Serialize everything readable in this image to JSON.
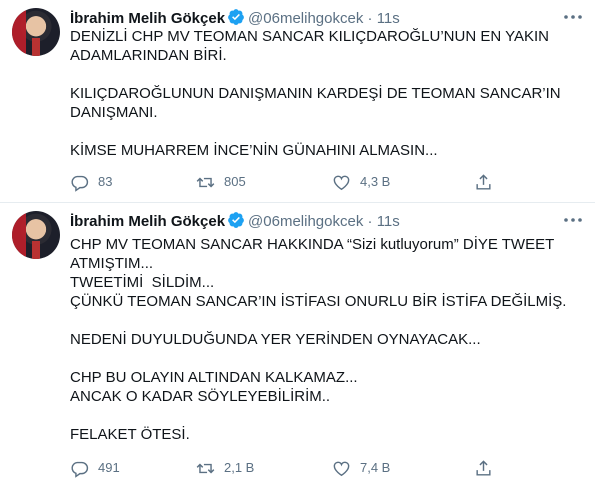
{
  "tweets": [
    {
      "author_name": "İbrahim Melih Gökçek",
      "handle": "@06melihgokcek",
      "separator": "·",
      "time": "11s",
      "text": "DENİZLİ CHP MV TEOMAN SANCAR KILIÇDAROĞLU’NUN EN YAKIN ADAMLARINDAN BİRİ.\n\nKILIÇDAROĞLUNUN DANIŞMANIN KARDEŞİ DE TEOMAN SANCAR’IN DANIŞMANI.\n\nKİMSE MUHARREM İNCE’NİN GÜNAHINI ALMASIN...",
      "replies": "83",
      "retweets": "805",
      "likes": "4,3 B"
    },
    {
      "author_name": "İbrahim Melih Gökçek",
      "handle": "@06melihgokcek",
      "separator": "·",
      "time": "11s",
      "text": "CHP MV TEOMAN SANCAR HAKKINDA “Sizi kutluyorum” DİYE TWEET ATMIŞTIM...\nTWEETİMİ  SİLDİM...\nÇÜNKÜ TEOMAN SANCAR’IN İSTİFASI ONURLU BİR İSTİFA DEĞİLMİŞ.\n\nNEDENİ DUYULDUĞUNDA YER YERİNDEN OYNAYACAK...\n\nCHP BU OLAYIN ALTINDAN KALKAMAZ...\nANCAK O KADAR SÖYLEYEBİLİRİM..\n\nFELAKET ÖTESİ.",
      "replies": "491",
      "retweets": "2,1 B",
      "likes": "7,4 B"
    }
  ],
  "colors": {
    "accent": "#1da1f2",
    "muted": "#5b7083",
    "text": "#0f1419",
    "divider": "#e6ecf0"
  },
  "icons": {
    "more": "more-horizontal-icon",
    "verified": "verified-badge-icon",
    "reply": "reply-icon",
    "retweet": "retweet-icon",
    "like": "heart-icon",
    "share": "share-icon"
  }
}
